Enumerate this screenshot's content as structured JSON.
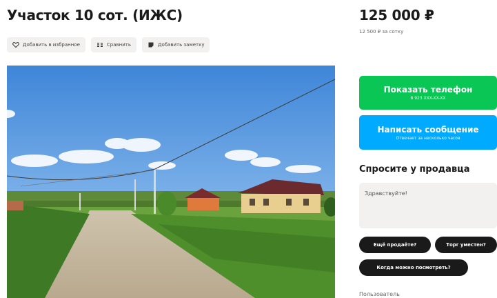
{
  "listing": {
    "title": "Участок 10 сот. (ИЖС)",
    "price": "125 000 ₽",
    "price_per_unit": "12 500 ₽ за сотку"
  },
  "actions": {
    "favorite": "Добавить в избранное",
    "compare": "Сравнить",
    "note": "Добавить заметку"
  },
  "contact": {
    "phone_button": "Показать телефон",
    "phone_masked": "8 923 XXX-XX-XX",
    "message_button": "Написать сообщение",
    "message_hint": "Отвечает за несколько часов"
  },
  "ask_seller": {
    "title": "Спросите у продавца",
    "message_value": "Здравствуйте!",
    "chips": [
      "Ещё продаёте?",
      "Торг уместен?",
      "Когда можно посмотреть?"
    ]
  },
  "seller": {
    "label": "Пользователь"
  },
  "colors": {
    "green": "#0ac654",
    "blue": "#00aaff",
    "chip_bg": "#1a1a1a",
    "action_bg": "#f2f1f0"
  },
  "icons": {
    "favorite": "heart-icon",
    "compare": "compare-icon",
    "note": "note-icon"
  }
}
